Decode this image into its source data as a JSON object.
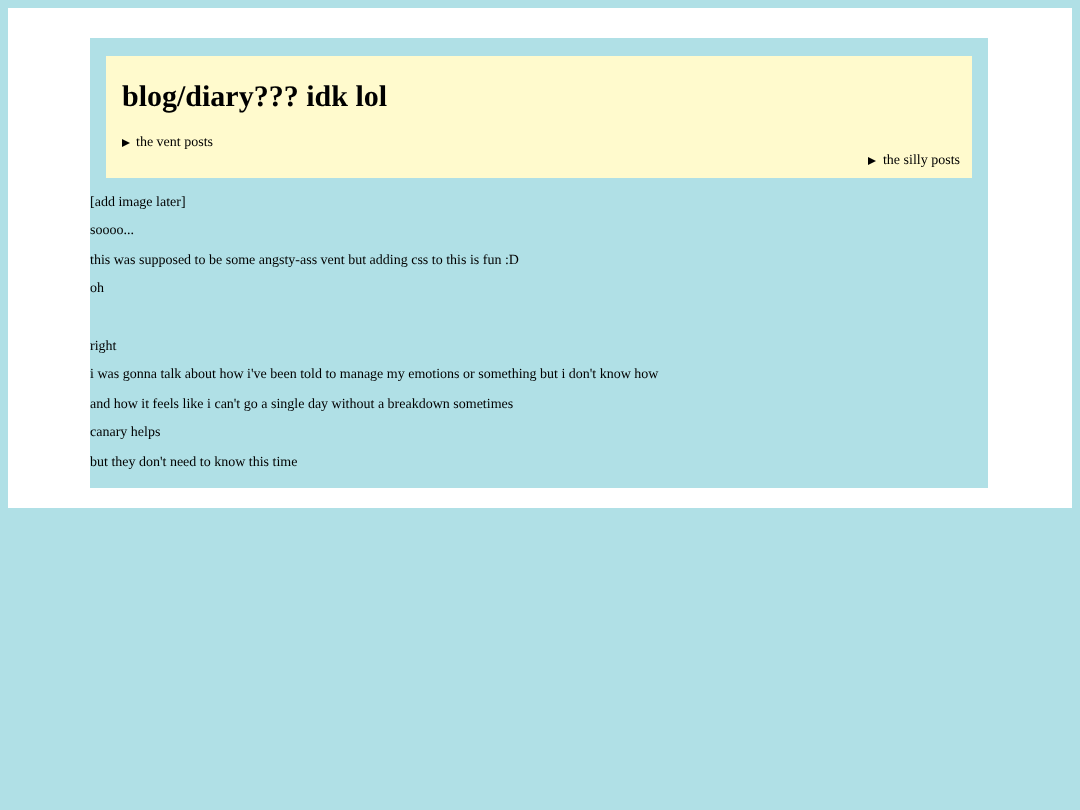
{
  "header": {
    "title": "blog/diary??? idk lol",
    "sections": [
      {
        "label": "the vent posts",
        "expanded": false,
        "kind": "left"
      },
      {
        "label": "the silly posts",
        "expanded": false,
        "kind": "right"
      }
    ]
  },
  "lines": [
    {
      "text": "[add image later]",
      "kind": "plain"
    },
    {
      "text": "soooo...",
      "kind": "plain"
    },
    {
      "text": "this was supposed to be some angsty-ass vent but adding css to this is fun :D",
      "kind": "plain"
    },
    {
      "text": "oh",
      "kind": "plain"
    },
    {
      "text": "right",
      "kind": "spaced"
    },
    {
      "text": "i was gonna talk about how i've been told to manage my emotions or something but i don't know how",
      "kind": "plain"
    },
    {
      "text": "and how it feels like i can't go a single day without a breakdown sometimes",
      "kind": "plain"
    },
    {
      "text": "canary helps",
      "kind": "plain"
    },
    {
      "text": "but they don't need to know this time",
      "kind": "plain"
    }
  ]
}
